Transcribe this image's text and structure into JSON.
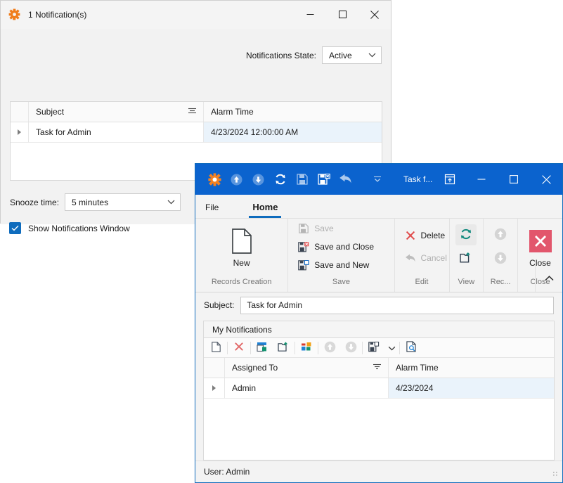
{
  "notifications_window": {
    "title": "1 Notification(s)",
    "app_icon": "gear-icon",
    "window_buttons": {
      "minimize": "minimize-icon",
      "maximize": "maximize-icon",
      "close": "close-icon"
    },
    "state_filter": {
      "label": "Notifications State:",
      "value": "Active"
    },
    "grid": {
      "columns": [
        "Subject",
        "Alarm Time"
      ],
      "rows": [
        {
          "subject": "Task for Admin",
          "alarm_time": "4/23/2024 12:00:00 AM"
        }
      ]
    },
    "snooze": {
      "label": "Snooze time:",
      "value": "5 minutes"
    },
    "show_window_checkbox": {
      "label": "Show Notifications Window",
      "checked": true
    }
  },
  "task_window": {
    "title": "Task f...",
    "quick_access": [
      {
        "name": "app-logo-icon",
        "label": "Application menu"
      },
      {
        "name": "move-up-icon",
        "label": "Move Up"
      },
      {
        "name": "move-down-icon",
        "label": "Move Down"
      },
      {
        "name": "refresh-icon",
        "label": "Refresh"
      },
      {
        "name": "save-icon",
        "label": "Save"
      },
      {
        "name": "save-and-close-icon",
        "label": "Save and Close"
      },
      {
        "name": "undo-icon",
        "label": "Undo"
      },
      {
        "name": "customize-qat-icon",
        "label": "Customize Quick Access Toolbar"
      }
    ],
    "restore_icon": "restore-down-icon",
    "window_buttons": {
      "minimize": "minimize-icon",
      "maximize": "maximize-icon",
      "close": "close-icon"
    },
    "tabs": [
      {
        "label": "File",
        "active": false
      },
      {
        "label": "Home",
        "active": true
      }
    ],
    "ribbon": {
      "groups": [
        {
          "label": "Records Creation",
          "buttons": [
            {
              "label": "New",
              "icon": "new-document-icon",
              "disabled": false
            }
          ]
        },
        {
          "label": "Save",
          "buttons": [
            {
              "label": "Save",
              "icon": "save-icon",
              "disabled": true
            },
            {
              "label": "Save and Close",
              "icon": "save-and-close-icon",
              "disabled": false
            },
            {
              "label": "Save and New",
              "icon": "save-and-new-icon",
              "disabled": false
            }
          ]
        },
        {
          "label": "Edit",
          "buttons": [
            {
              "label": "Delete",
              "icon": "delete-x-icon",
              "disabled": false
            },
            {
              "label": "Cancel",
              "icon": "cancel-undo-icon",
              "disabled": true
            }
          ]
        },
        {
          "label": "View",
          "buttons": [
            {
              "label": "",
              "icon": "refresh-icon",
              "disabled": false
            },
            {
              "label": "",
              "icon": "export-icon",
              "disabled": false
            }
          ]
        },
        {
          "label": "Rec...",
          "buttons": [
            {
              "label": "",
              "icon": "move-up-icon",
              "disabled": true
            },
            {
              "label": "",
              "icon": "move-down-icon",
              "disabled": true
            }
          ]
        },
        {
          "label": "Close",
          "buttons": [
            {
              "label": "Close",
              "icon": "close-x-icon",
              "disabled": false
            }
          ]
        }
      ],
      "collapse_icon": "chevron-up-icon"
    },
    "subject": {
      "label": "Subject:",
      "value": "Task for Admin",
      "placeholder": ""
    },
    "panel": {
      "tab_label": "My Notifications",
      "toolbar": [
        {
          "name": "new-record-icon"
        },
        {
          "name": "delete-record-icon"
        },
        {
          "name": "edit-window-icon"
        },
        {
          "name": "export-icon"
        },
        {
          "name": "layout-blocks-icon"
        },
        {
          "name": "move-up-icon"
        },
        {
          "name": "move-down-icon"
        },
        {
          "name": "save-layout-icon"
        },
        {
          "name": "chevron-down-icon"
        },
        {
          "name": "preview-icon"
        }
      ],
      "grid": {
        "columns": [
          "Assigned To",
          "Alarm Time"
        ],
        "rows": [
          {
            "assigned_to": "Admin",
            "alarm_time": "4/23/2024"
          }
        ]
      }
    },
    "status_bar": {
      "user": "User: Admin",
      "grip": "resize-grip-icon"
    }
  },
  "colors": {
    "titlebar_blue": "#0b63ce",
    "accent_blue": "#0f6cbd",
    "orange": "#f07c1b",
    "teal": "#10897d",
    "red": "#e2566c",
    "delete_red": "#e04a4a",
    "selection_row": "#eaf3fb"
  }
}
